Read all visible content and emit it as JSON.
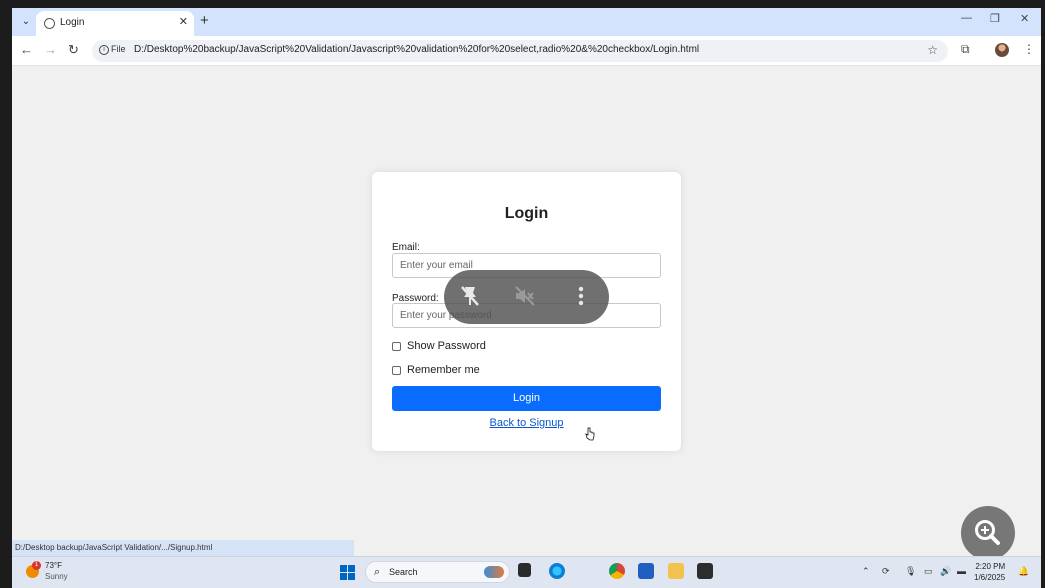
{
  "browser": {
    "tab": {
      "title": "Login",
      "close": "✕"
    },
    "new_tab": "+",
    "window_controls": {
      "minimize": "—",
      "restore": "❐",
      "close": "✕"
    },
    "nav": {
      "back": "←",
      "forward": "→",
      "reload": "↻"
    },
    "omnibox": {
      "info": "i",
      "scheme_chip": "File",
      "url": "D:/Desktop%20backup/JavaScript%20Validation/Javascript%20validation%20for%20select,radio%20&%20checkbox/Login.html"
    }
  },
  "login": {
    "title": "Login",
    "email_label": "Email:",
    "email_placeholder": "Enter your email",
    "password_label": "Password:",
    "password_placeholder": "Enter your password",
    "show_password": "Show Password",
    "remember_me": "Remember me",
    "submit": "Login",
    "signup_link": "Back to Signup"
  },
  "status_bar": {
    "url": "D:/Desktop backup/JavaScript Validation/.../Signup.html"
  },
  "taskbar": {
    "weather": {
      "badge": "1",
      "temp": "73°F",
      "condition": "Sunny"
    },
    "search": "Search",
    "clock": {
      "time": "2:20 PM",
      "date": "1/6/2025"
    }
  },
  "colors": {
    "accent": "#0a6cff",
    "tabstrip": "#d3e3fd",
    "page_bg": "#f0f0f0",
    "link": "#0b57d0"
  }
}
